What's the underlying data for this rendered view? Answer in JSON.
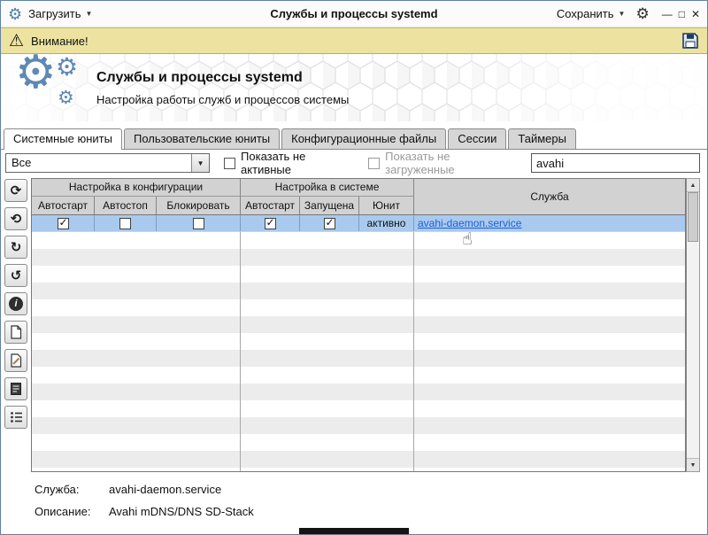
{
  "titlebar": {
    "load_label": "Загрузить",
    "title": "Службы и процессы systemd",
    "save_label": "Сохранить"
  },
  "warning": {
    "text": "Внимание!"
  },
  "header": {
    "title": "Службы и процессы systemd",
    "subtitle": "Настройка работы служб и процессов системы"
  },
  "tabs": [
    {
      "label": "Системные юниты",
      "active": true
    },
    {
      "label": "Пользовательские юниты",
      "active": false
    },
    {
      "label": "Конфигурационные файлы",
      "active": false
    },
    {
      "label": "Сессии",
      "active": false
    },
    {
      "label": "Таймеры",
      "active": false
    }
  ],
  "filters": {
    "state_filter_value": "Все",
    "show_inactive_label": "Показать не активные",
    "show_inactive_checked": false,
    "show_unloaded_label": "Показать не загруженные",
    "show_unloaded_checked": false,
    "search_value": "avahi"
  },
  "table": {
    "group_config": "Настройка в конфигурации",
    "group_system": "Настройка в системе",
    "col_service": "Служба",
    "sub_headers": [
      "Автостарт",
      "Автостоп",
      "Блокировать",
      "Автостарт",
      "Запущена",
      "Юнит"
    ],
    "row": {
      "autostart_config": true,
      "autostop": false,
      "block": false,
      "autostart_system": true,
      "running": true,
      "unit_status": "активно",
      "service": "avahi-daemon.service"
    },
    "empty_row_count": 15
  },
  "details": {
    "service_label": "Служба:",
    "service_value": "avahi-daemon.service",
    "description_label": "Описание:",
    "description_value": "Avahi mDNS/DNS SD-Stack"
  },
  "colors": {
    "accent_blue": "#5d89b4",
    "selection": "#a9caee",
    "warning_bg": "#ece3a0",
    "link": "#1f5fd6"
  },
  "icons": {
    "app_gear": "⚙",
    "settings_gear": "⚙",
    "dropdown_caret": "▼",
    "combo_arrow": "▼",
    "warning": "⚠",
    "minimize": "—",
    "maximize": "□",
    "close": "✕",
    "refresh": "⟳",
    "reload_timer": "⟲",
    "restart": "↻",
    "undo": "↺",
    "info": "i",
    "scroll_up": "▲",
    "scroll_down": "▼",
    "cursor_hand": "☝",
    "gear_logo": "⚙"
  }
}
